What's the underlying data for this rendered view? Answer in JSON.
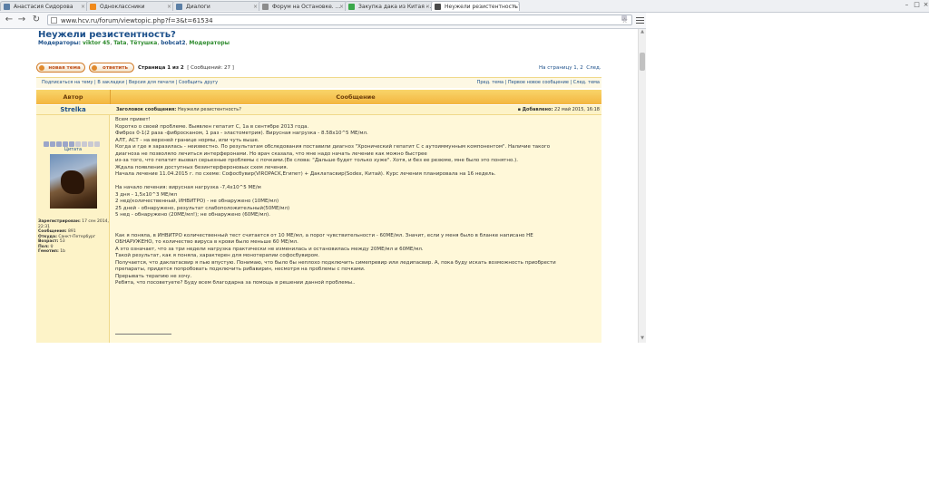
{
  "browser": {
    "tabs": [
      {
        "label": "Анастасия Сидорова",
        "color": "#5b7fa6",
        "active": false
      },
      {
        "label": "Одноклассники",
        "color": "#f08a1c",
        "active": false
      },
      {
        "label": "Диалоги",
        "color": "#5b7fa6",
        "active": false
      },
      {
        "label": "Форум на Остановке. ...",
        "color": "#8c8c8c",
        "active": false
      },
      {
        "label": "Закупка дака из Китая - ...",
        "color": "#3aa84a",
        "active": false
      },
      {
        "label": "Неужели резистентность? ...",
        "color": "#4a4a4a",
        "active": true
      }
    ],
    "url": "www.hcv.ru/forum/viewtopic.php?f=3&t=61534"
  },
  "topic": {
    "title": "Неужели резистентность?",
    "moderators_label": "Модераторы:",
    "moderators": [
      "viktor 45",
      "Tata",
      "Tётушка",
      "bobcat2",
      "Модераторы"
    ]
  },
  "actions": {
    "new_topic": "новая тема",
    "reply": "ответить",
    "page_info": "Страница 1 из 2",
    "post_count": "[ Сообщений: 27 ]",
    "jump_label": "На страницу 1, 2",
    "next_label": "След."
  },
  "linkbar": {
    "left": "Подписаться на тему | В закладки | Версия для печати | Сообщить другу",
    "right": "Пред. тема | Первое новое сообщение | След. тема"
  },
  "table_header": {
    "author": "Автор",
    "message": "Сообщение"
  },
  "post": {
    "author": "Strelka",
    "subject_label": "Заголовок сообщения:",
    "subject": "Неужели резистентность?",
    "date_label": "Добавлено:",
    "date": "22 май 2015, 16:18",
    "quote_label": "Цитата",
    "stars_on": 5,
    "stars_total": 9,
    "info": [
      {
        "label": "Зарегистрирован:",
        "value": "17 сен 2014, 22:31"
      },
      {
        "label": "Сообщения:",
        "value": "891"
      },
      {
        "label": "Откуда:",
        "value": "Санкт-Петербург"
      },
      {
        "label": "Возраст:",
        "value": "53"
      },
      {
        "label": "Пол:",
        "value": "♀"
      },
      {
        "label": "Генотип:",
        "value": "1b"
      }
    ],
    "body": [
      "Всем привет!",
      "Коротко о своей проблеме. Выявлен гепатит С, 1а в сентябре 2013 года.",
      "Фиброз 0-1(2 раза -фибросканом, 1 раз - эластометрия). Вирусная нагрузка - 8.58x10^5 МЕ/мл.",
      "АЛТ, АСТ - на верхней границе нормы, или чуть выше.",
      "Когда и где я заразилась - неизвестно. По результатам обследования поставили диагноз \"Хронический гепатит С с аутоиммунным компонентом\". Наличие такого",
      "диагноза не позволяло лечиться интерферонами. Но врач сказала, что мне надо начать лечение как можно быстрее",
      "из-за того, что гепатит вызвал серьезные проблемы с почками.(Ее слова: \"Дальше будет только хуже\". Хотя, и без ее резюме, мне было это понятно.).",
      "Ждала появления доступных безинтерфероновых схем лечения.",
      "Начала лечение 11.04.2015 г. по схеме: Софосбувир(VIROPACK,Египет) + Даклатасвир(Sodex, Китай). Курс лечения планировала на 16 недель.",
      "",
      "На начало лечения: вирусная нагрузка -7,4x10^5 МЕ/м",
      "3 дня - 1,5x10^3 МЕ/мл",
      "2 нед(количественный, ИНВИТРО) - не обнаружено (10МЕ/мл)",
      "25 дней - обнаружено, результат слабоположительный(50МЕ/мл)",
      "5 нед - обнаружено (20МЕ/мл!); не обнаружено (60МЕ/мл).",
      "",
      "",
      "Как я поняла, в ИНВИТРО количественный тест считается от 10 МЕ/мл, а порог чувствительности - 60МЕ/мл. Значит, если у меня было в бланке написано НЕ",
      "ОБНАРУЖЕНО, то количество вируса в крови было меньше 60 МЕ/мл.",
      "А это означает, что за три недели нагрузка практически не изменилась и остановилась между 20МЕ/мл и 60МЕ/мл.",
      "Такой результат, как я поняла, характерен для монотерапии софосбувиром.",
      "Получается, что даклатасвир я пью впустую. Понимаю, что было бы неплохо подключить симепревир или ледипасвир. А, пока буду искать возможность приобрести",
      "препараты, придется попробовать подключить рибавирин, несмотря на проблемы с почками.",
      "Прерывать терапию не хочу.",
      "Ребята, что посоветуете? Буду всем благодарна за помощь в решении данной проблемы.."
    ]
  }
}
